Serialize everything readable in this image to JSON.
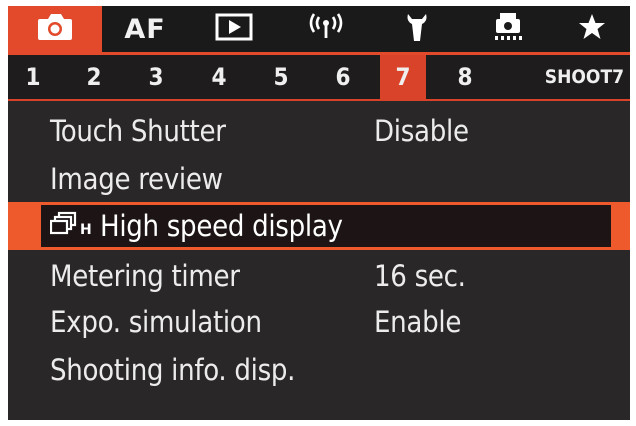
{
  "tabs": [
    {
      "name": "camera-icon",
      "label": "",
      "active": true
    },
    {
      "name": "af",
      "label": "AF",
      "active": false
    },
    {
      "name": "play-icon",
      "label": "",
      "active": false
    },
    {
      "name": "wireless-icon",
      "label": "",
      "active": false
    },
    {
      "name": "wrench-icon",
      "label": "",
      "active": false
    },
    {
      "name": "custom-function-icon",
      "label": "",
      "active": false
    },
    {
      "name": "star-icon",
      "label": "",
      "active": false
    }
  ],
  "pages": [
    "1",
    "2",
    "3",
    "4",
    "5",
    "6",
    "7",
    "8"
  ],
  "active_page": "7",
  "section_label": "SHOOT7",
  "menu": [
    {
      "label": "Touch Shutter",
      "value": "Disable",
      "selected": false
    },
    {
      "label": "Image review",
      "value": "",
      "selected": false
    },
    {
      "label": "High speed display",
      "value": "",
      "selected": true,
      "icon": "high-speed-display-icon"
    },
    {
      "label": "Metering timer",
      "value": "16 sec.",
      "selected": false
    },
    {
      "label": "Expo. simulation",
      "value": "Enable",
      "selected": false
    },
    {
      "label": "Shooting info. disp.",
      "value": "",
      "selected": false
    }
  ],
  "colors": {
    "accent": "#e24a2b",
    "background": "#2a2728",
    "text": "#ececec"
  }
}
